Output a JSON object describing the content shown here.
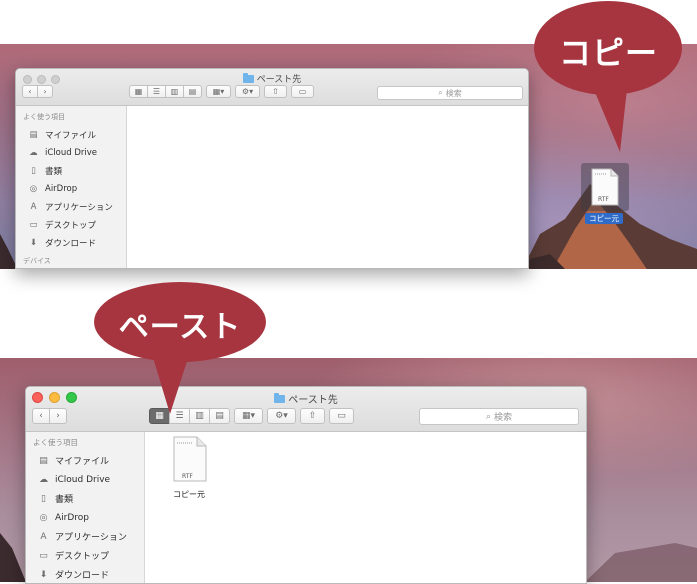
{
  "callouts": {
    "copy": "コピー",
    "paste": "ペースト"
  },
  "window1": {
    "title": "ペースト先",
    "search_placeholder": "検索",
    "sidebar": {
      "favorites_header": "よく使う項目",
      "items": [
        {
          "label": "マイファイル",
          "icon": "all-files-icon"
        },
        {
          "label": "iCloud Drive",
          "icon": "cloud-icon"
        },
        {
          "label": "書類",
          "icon": "documents-icon"
        },
        {
          "label": "AirDrop",
          "icon": "airdrop-icon"
        },
        {
          "label": "アプリケーション",
          "icon": "applications-icon"
        },
        {
          "label": "デスクトップ",
          "icon": "desktop-icon"
        },
        {
          "label": "ダウンロード",
          "icon": "download-icon"
        }
      ],
      "devices_header": "デバイス"
    }
  },
  "desktop_file": {
    "type_label": "RTF",
    "name": "コピー元"
  },
  "window2": {
    "title": "ペースト先",
    "search_placeholder": "検索",
    "sidebar": {
      "favorites_header": "よく使う項目",
      "items": [
        {
          "label": "マイファイル",
          "icon": "all-files-icon"
        },
        {
          "label": "iCloud Drive",
          "icon": "cloud-icon"
        },
        {
          "label": "書類",
          "icon": "documents-icon"
        },
        {
          "label": "AirDrop",
          "icon": "airdrop-icon"
        },
        {
          "label": "アプリケーション",
          "icon": "applications-icon"
        },
        {
          "label": "デスクトップ",
          "icon": "desktop-icon"
        },
        {
          "label": "ダウンロード",
          "icon": "download-icon"
        }
      ]
    },
    "file": {
      "type_label": "RTF",
      "name": "コピー元"
    }
  },
  "colors": {
    "callout": "#a6353f",
    "selection": "#2f6bc9",
    "active_view": "#6b6b6b"
  }
}
